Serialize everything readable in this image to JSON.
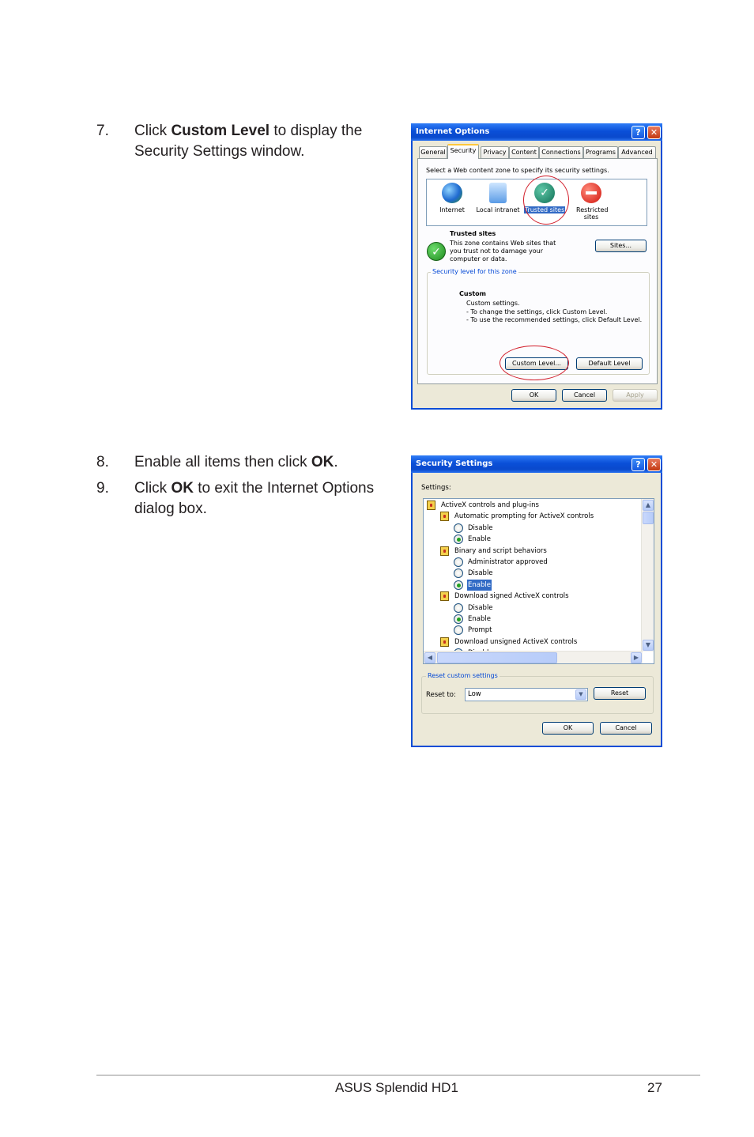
{
  "steps": [
    {
      "num": "7.",
      "pre": "Click ",
      "bold": "Custom Level",
      "post": " to display the Security Settings window."
    },
    {
      "num": "8.",
      "pre": "Enable all items then click ",
      "bold": "OK",
      "post": "."
    },
    {
      "num": "9.",
      "pre": "Click ",
      "bold": "OK",
      "post": " to exit the Internet Options dialog box."
    }
  ],
  "internet_options": {
    "title": "Internet Options",
    "tabs": [
      "General",
      "Security",
      "Privacy",
      "Content",
      "Connections",
      "Programs",
      "Advanced"
    ],
    "zone_prompt": "Select a Web content zone to specify its security settings.",
    "zones": [
      "Internet",
      "Local intranet",
      "Trusted sites",
      "Restricted sites"
    ],
    "zone_heading": "Trusted sites",
    "zone_desc": "This zone contains Web sites that you trust not to damage your computer or data.",
    "sites_button": "Sites...",
    "level_group": "Security level for this zone",
    "level_name": "Custom",
    "level_lines": [
      "Custom settings.",
      "- To change the settings, click Custom Level.",
      "- To use the recommended settings, click Default Level."
    ],
    "custom_level_button": "Custom Level...",
    "default_level_button": "Default Level",
    "ok": "OK",
    "cancel": "Cancel",
    "apply": "Apply"
  },
  "security_settings": {
    "title": "Security Settings",
    "settings_label": "Settings:",
    "tree": [
      {
        "kind": "category",
        "level": 0,
        "label": "ActiveX controls and plug-ins"
      },
      {
        "kind": "category",
        "level": 1,
        "label": "Automatic prompting for ActiveX controls"
      },
      {
        "kind": "radio",
        "level": 2,
        "label": "Disable",
        "on": false
      },
      {
        "kind": "radio",
        "level": 2,
        "label": "Enable",
        "on": true
      },
      {
        "kind": "category",
        "level": 1,
        "label": "Binary and script behaviors"
      },
      {
        "kind": "radio",
        "level": 2,
        "label": "Administrator approved",
        "on": false
      },
      {
        "kind": "radio",
        "level": 2,
        "label": "Disable",
        "on": false
      },
      {
        "kind": "radio",
        "level": 2,
        "label": "Enable",
        "on": true,
        "selected": true
      },
      {
        "kind": "category",
        "level": 1,
        "label": "Download signed ActiveX controls"
      },
      {
        "kind": "radio",
        "level": 2,
        "label": "Disable",
        "on": false
      },
      {
        "kind": "radio",
        "level": 2,
        "label": "Enable",
        "on": true
      },
      {
        "kind": "radio",
        "level": 2,
        "label": "Prompt",
        "on": false
      },
      {
        "kind": "category",
        "level": 1,
        "label": "Download unsigned ActiveX controls"
      },
      {
        "kind": "radio",
        "level": 2,
        "label": "Disable",
        "on": false
      }
    ],
    "reset_group": "Reset custom settings",
    "reset_to_label": "Reset to:",
    "reset_value": "Low",
    "reset_button": "Reset",
    "ok": "OK",
    "cancel": "Cancel"
  },
  "footer": {
    "title": "ASUS Splendid HD1",
    "page": "27"
  },
  "colors": {
    "xp_blue": "#0a4dd6",
    "highlight": "#316ac5",
    "annotation_red": "#d21f2b"
  }
}
